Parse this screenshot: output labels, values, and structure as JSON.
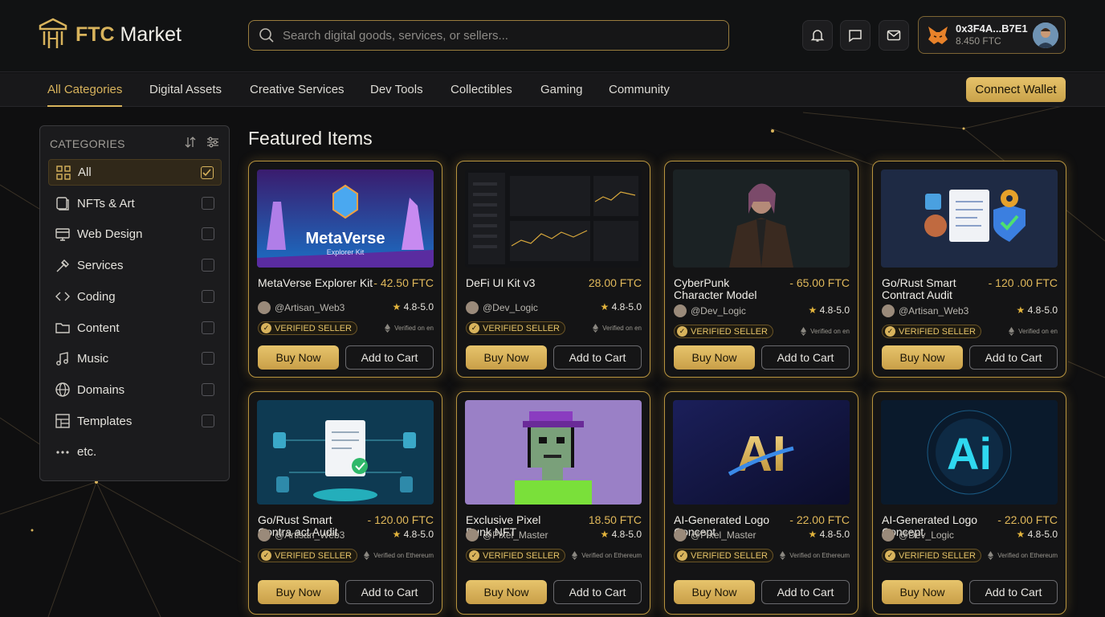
{
  "brand": {
    "name_bold": "FTC",
    "name_rest": " Market"
  },
  "search": {
    "placeholder": "Search digital goods, services, or sellers..."
  },
  "wallet": {
    "address": "0x3F4A...B7E1",
    "balance": "8.450 FTC"
  },
  "nav": {
    "tabs": [
      "All Categories",
      "Digital Assets",
      "Creative Services",
      "Dev Tools",
      "Collectibles",
      "Gaming",
      "Community"
    ],
    "connect_label": "Connect Wallet"
  },
  "sidebar": {
    "heading": "CATEGORIES",
    "items": [
      {
        "label": "All",
        "icon": "grid-icon",
        "checked": true
      },
      {
        "label": "NFTs & Art",
        "icon": "nft-icon",
        "checked": false
      },
      {
        "label": "Web Design",
        "icon": "monitor-icon",
        "checked": false
      },
      {
        "label": "Services",
        "icon": "tools-icon",
        "checked": false
      },
      {
        "label": "Coding",
        "icon": "code-icon",
        "checked": false
      },
      {
        "label": "Content",
        "icon": "folder-icon",
        "checked": false
      },
      {
        "label": "Music",
        "icon": "music-icon",
        "checked": false
      },
      {
        "label": "Domains",
        "icon": "globe-icon",
        "checked": false
      },
      {
        "label": "Templates",
        "icon": "template-icon",
        "checked": false
      },
      {
        "label": "etc.",
        "icon": "more-icon",
        "checked": null
      }
    ]
  },
  "main": {
    "heading": "Featured Items",
    "buy_label": "Buy Now",
    "cart_label": "Add to Cart",
    "badge_label": "VERIFIED SELLER",
    "items": [
      {
        "title": "MetaVerse Explorer Kit",
        "price": "- 42.50 FTC",
        "seller": "@Artisan_Web3",
        "rating": "4.8-5.0",
        "verified": "Verified on en",
        "art": "metaverse",
        "art_text": "MetaVerse",
        "art_sub": "Explorer Kit"
      },
      {
        "title": "DeFi UI Kit v3",
        "price": "28.00 FTC",
        "seller": "@Dev_Logic",
        "rating": "4.8-5.0",
        "verified": "Verified on en",
        "art": "defi"
      },
      {
        "title": "CyberPunk Character Model",
        "price": "- 65.00 FTC",
        "seller": "@Dev_Logic",
        "rating": "4.8-5.0",
        "verified": "Verified on en",
        "art": "cyberpunk"
      },
      {
        "title": "Go/Rust Smart Contract Audit",
        "price": "- 120 .00 FTC",
        "seller": "@Artisan_Web3",
        "rating": "4.8-5.0",
        "verified": "Verified on en",
        "art": "audit"
      },
      {
        "title": "Go/Rust Smart Contra act Audit",
        "price": "- 120.00 FTC",
        "seller": "@Artisan_Web3",
        "rating": "4.8-5.0",
        "verified": "Verified on Ethereum",
        "art": "cloud"
      },
      {
        "title": "Exclusive Pixel Punk NFT",
        "price": "18.50 FTC",
        "seller": "@Pixel_Master",
        "rating": "4.8-5.0",
        "verified": "Verified on Ethereum",
        "art": "pixel"
      },
      {
        "title": "AI-Generated Logo Concept",
        "price": "- 22.00 FTC",
        "seller": "@Pixel_Master",
        "rating": "4.8-5.0",
        "verified": "Verified on Ethereum",
        "art": "ai-gold",
        "art_text": "AI"
      },
      {
        "title": "AI-Generated Logo Concept",
        "price": "- 22.00 FTC",
        "seller": "@Dev_Logic",
        "rating": "4.8-5.0",
        "verified": "Verified on Ethereum",
        "art": "ai-blue",
        "art_text": "Ai"
      }
    ]
  },
  "colors": {
    "accent": "#d8b35c",
    "background": "#0f0f10",
    "card_border": "#b8943e"
  }
}
